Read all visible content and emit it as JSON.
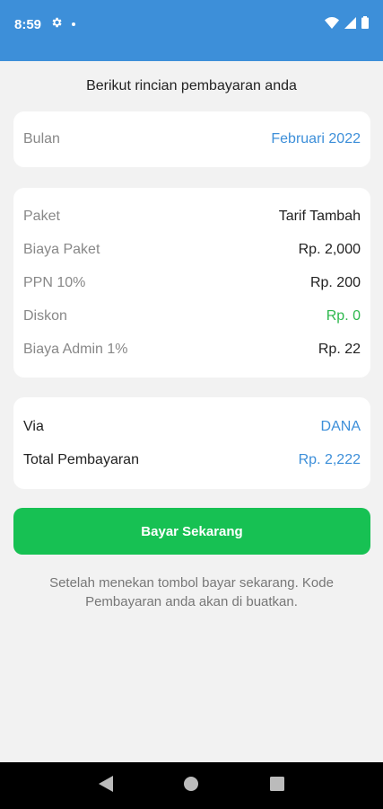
{
  "status_bar": {
    "time": "8:59"
  },
  "heading": "Berikut rincian pembayaran anda",
  "month_card": {
    "label": "Bulan",
    "value": "Februari 2022"
  },
  "detail_card": {
    "rows": [
      {
        "label": "Paket",
        "value": "Tarif Tambah"
      },
      {
        "label": "Biaya Paket",
        "value": "Rp. 2,000"
      },
      {
        "label": "PPN 10%",
        "value": "Rp. 200"
      },
      {
        "label": "Diskon",
        "value": "Rp. 0"
      },
      {
        "label": "Biaya Admin 1%",
        "value": "Rp. 22"
      }
    ]
  },
  "payment_card": {
    "via_label": "Via",
    "via_value": "DANA",
    "total_label": "Total Pembayaran",
    "total_value": "Rp. 2,222"
  },
  "pay_button": "Bayar Sekarang",
  "note": "Setelah menekan tombol bayar sekarang. Kode Pembayaran anda akan di buatkan.",
  "colors": {
    "status_bar": "#3d8fd9",
    "accent_blue": "#3d8fd9",
    "button_green": "#17c153",
    "discount_green": "#2db84d"
  }
}
